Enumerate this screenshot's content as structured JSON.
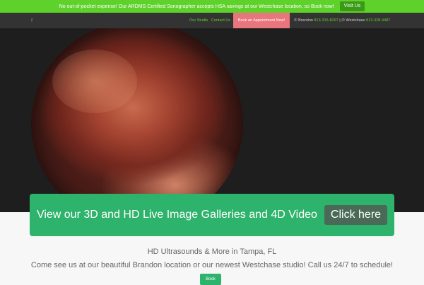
{
  "promo": {
    "text": "No out-of-pocket expense! Our ARDMS Certified Sonographer accepts HSA savings at our Westchase location, so Book now!",
    "button": "Visit Us"
  },
  "nav": {
    "facebook_icon": "f",
    "links": [
      "Our Studio",
      "Contact Us"
    ],
    "appointment_button": "Book an Appointment Now!",
    "brandon_label": "Brandon",
    "brandon_phone": "813-315-8297",
    "separator": "|",
    "westchase_label": "Westchase",
    "westchase_phone": "813-328-4487",
    "phone_icon": "✆"
  },
  "gallery": {
    "text": "View our 3D and HD Live Image Galleries and 4D Video",
    "button": "Click here"
  },
  "content": {
    "tagline": "HD Ultrasounds & More in Tampa, FL",
    "subtext": "Come see us at our beautiful Brandon location or our newest Westchase studio! Call us 24/7 to schedule!",
    "book_button": "Book"
  },
  "colors": {
    "accent_green": "#5fd12b",
    "banner_green": "#2db36b",
    "appointment_pink": "#e9757d",
    "nav_dark": "#333333"
  }
}
